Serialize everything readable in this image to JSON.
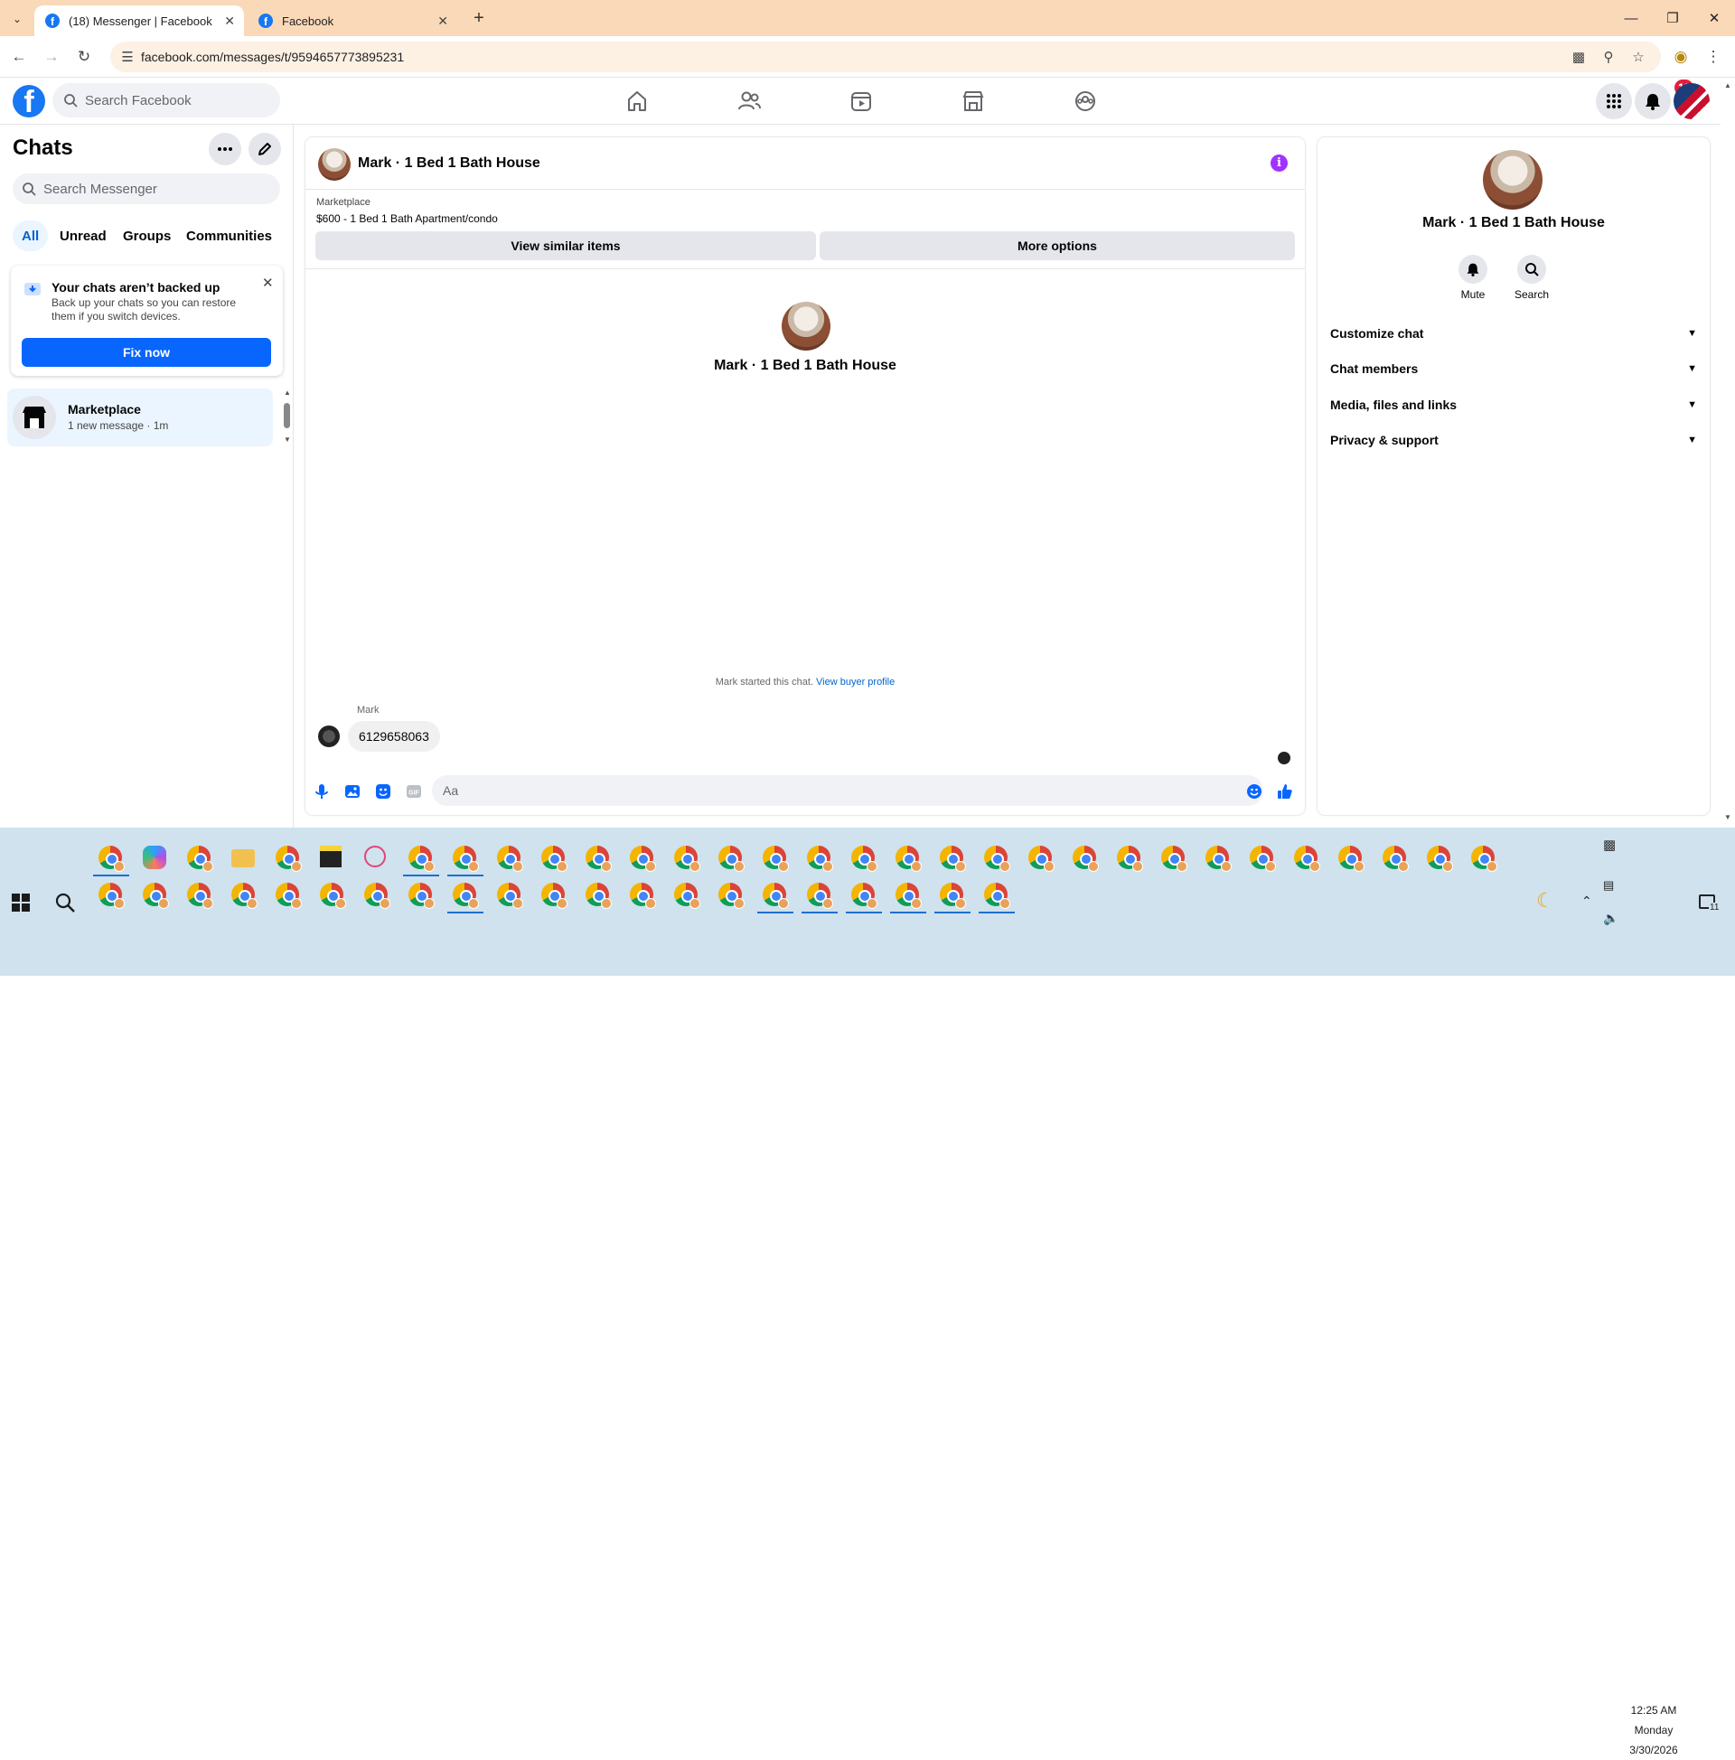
{
  "browser": {
    "tabs": [
      {
        "title": "(18) Messenger | Facebook",
        "active": true
      },
      {
        "title": "Facebook",
        "active": false
      }
    ],
    "url": "facebook.com/messages/t/9594657773895231"
  },
  "fb_header": {
    "search_placeholder": "Search Facebook",
    "nav_icons": [
      "home-icon",
      "friends-icon",
      "video-icon",
      "marketplace-icon",
      "groups-icon"
    ],
    "notification_count": "18",
    "brand_color": "#1877f2"
  },
  "left": {
    "title": "Chats",
    "search_placeholder": "Search Messenger",
    "filters": [
      "All",
      "Unread",
      "Groups",
      "Communities"
    ],
    "backup": {
      "title": "Your chats aren’t backed up",
      "desc": "Back up your chats so you can restore them if you switch devices.",
      "button": "Fix now"
    },
    "conversations": [
      {
        "name": "Marketplace",
        "sub": "1 new message · 1m"
      }
    ]
  },
  "chat": {
    "title": "Mark · 1 Bed 1 Bath House",
    "marketplace_label": "Marketplace",
    "item": "$600 - 1 Bed 1 Bath Apartment/condo",
    "btn_similar": "View similar items",
    "btn_more": "More options",
    "intro_name": "Mark · 1 Bed 1 Bath House",
    "started_text": "Mark started this chat.",
    "started_link": "View buyer profile",
    "sender": "Mark",
    "message": "6129658063",
    "composer_placeholder": "Aa"
  },
  "right": {
    "name": "Mark · 1 Bed 1 Bath House",
    "mute": "Mute",
    "search": "Search",
    "sections": [
      "Customize chat",
      "Chat members",
      "Media, files and links",
      "Privacy & support"
    ]
  },
  "taskbar": {
    "time": "12:25 AM",
    "day": "Monday",
    "date": "3/30/2026",
    "notification_count": "11"
  }
}
